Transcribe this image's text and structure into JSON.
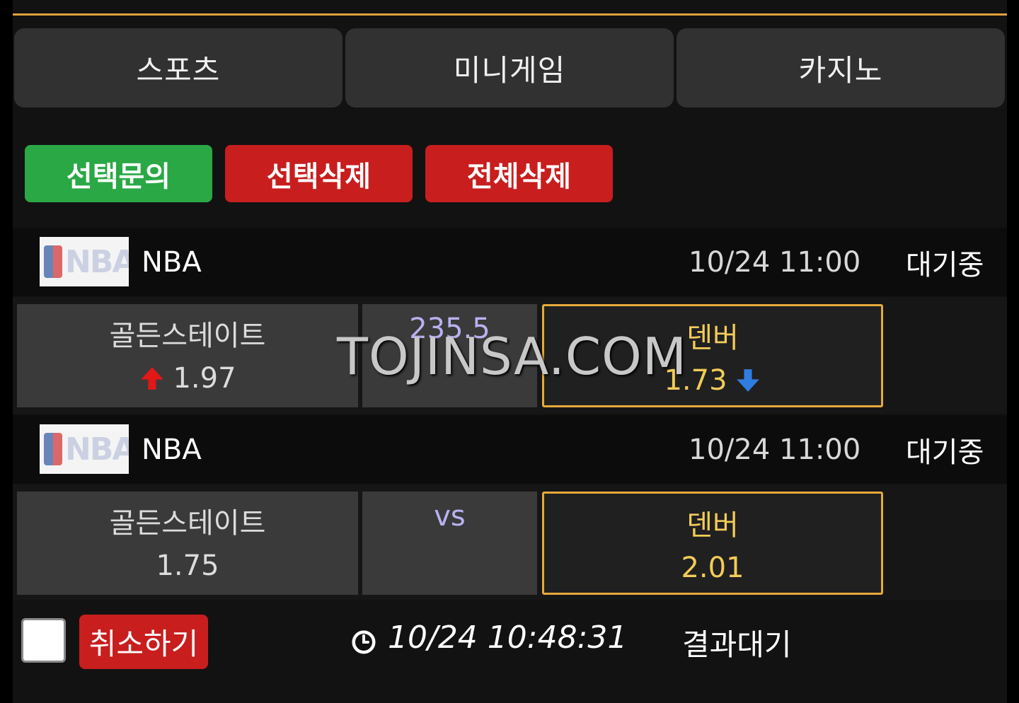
{
  "tabs": [
    {
      "label": "스포츠"
    },
    {
      "label": "미니게임"
    },
    {
      "label": "카지노"
    }
  ],
  "actions": {
    "inquiry_label": "선택문의",
    "delete_selected_label": "선택삭제",
    "delete_all_label": "전체삭제"
  },
  "matches": [
    {
      "league": "NBA",
      "logo_text": "NBA",
      "time": "10/24 11:00",
      "status": "대기중",
      "home": {
        "name": "골든스테이트",
        "odds": "1.97",
        "trend": "up"
      },
      "middle": "235.5",
      "away": {
        "name": "덴버",
        "odds": "1.73",
        "trend": "down",
        "selected": true
      }
    },
    {
      "league": "NBA",
      "logo_text": "NBA",
      "time": "10/24 11:00",
      "status": "대기중",
      "home": {
        "name": "골든스테이트",
        "odds": "1.75"
      },
      "middle": "vs",
      "away": {
        "name": "덴버",
        "odds": "2.01",
        "selected": true
      }
    }
  ],
  "watermark": "TOJINSA.COM",
  "footer": {
    "cancel_label": "취소하기",
    "bet_time": "10/24 10:48:31",
    "result_status": "결과대기"
  },
  "colors": {
    "accent_line": "#e0a13a",
    "selected_border": "#e6a93a",
    "selected_text": "#f2cc58",
    "green_button": "#2aa845",
    "red_button": "#c81e1e",
    "odds_up": "#e01818",
    "odds_down": "#2f7de0",
    "middle_text": "#b8b2f2"
  },
  "icons": [
    "arrow-up-icon",
    "arrow-down-icon",
    "clock-icon",
    "nba-logo"
  ]
}
